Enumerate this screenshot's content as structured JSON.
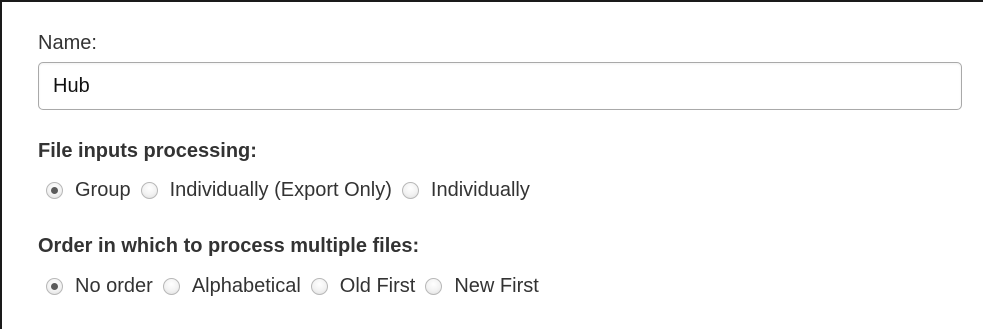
{
  "name_field": {
    "label": "Name:",
    "value": "Hub"
  },
  "file_inputs": {
    "title": "File inputs processing:",
    "options": [
      {
        "label": "Group",
        "checked": true
      },
      {
        "label": "Individually (Export Only)",
        "checked": false
      },
      {
        "label": "Individually",
        "checked": false
      }
    ]
  },
  "order": {
    "title": "Order in which to process multiple files:",
    "options": [
      {
        "label": "No order",
        "checked": true
      },
      {
        "label": "Alphabetical",
        "checked": false
      },
      {
        "label": "Old First",
        "checked": false
      },
      {
        "label": "New First",
        "checked": false
      }
    ]
  }
}
